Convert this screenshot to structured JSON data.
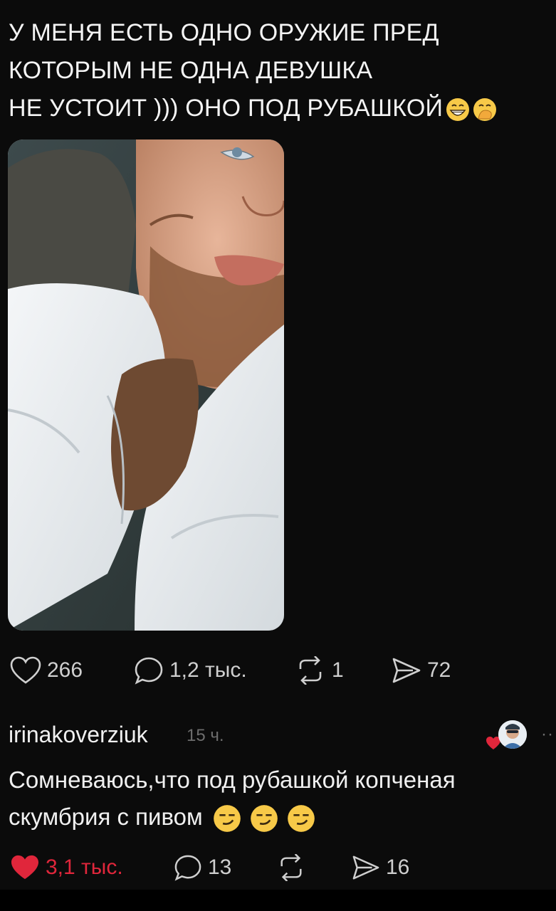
{
  "post": {
    "lines": [
      "У МЕНЯ ЕСТЬ ОДНО ОРУЖИЕ ПРЕД",
      "КОТОРЫМ НЕ ОДНА ДЕВУШКА",
      "НЕ УСТОИТ ))) ОНО ПОД РУБАШКОЙ"
    ],
    "emojis": [
      "grinning-face-with-smiling-eyes",
      "face-with-hand-over-mouth"
    ],
    "photo": "selfie-man-in-white-shirt"
  },
  "post_actions": {
    "likes": "266",
    "comments": "1,2 тыс.",
    "reposts": "1",
    "shares": "72"
  },
  "comment": {
    "author": "irinakoverziuk",
    "time": "15 ч.",
    "text_lines": [
      "Сомневаюсь,что под рубашкой копченая",
      "скумбрия с пивом"
    ],
    "emojis": [
      "smirking-face",
      "smirking-face",
      "smirking-face"
    ],
    "liked_by_author": true,
    "more": "··"
  },
  "comment_actions": {
    "likes": "3,1 тыс.",
    "comments": "13",
    "reposts": "",
    "shares": "16",
    "like_color": "#e0263b"
  }
}
